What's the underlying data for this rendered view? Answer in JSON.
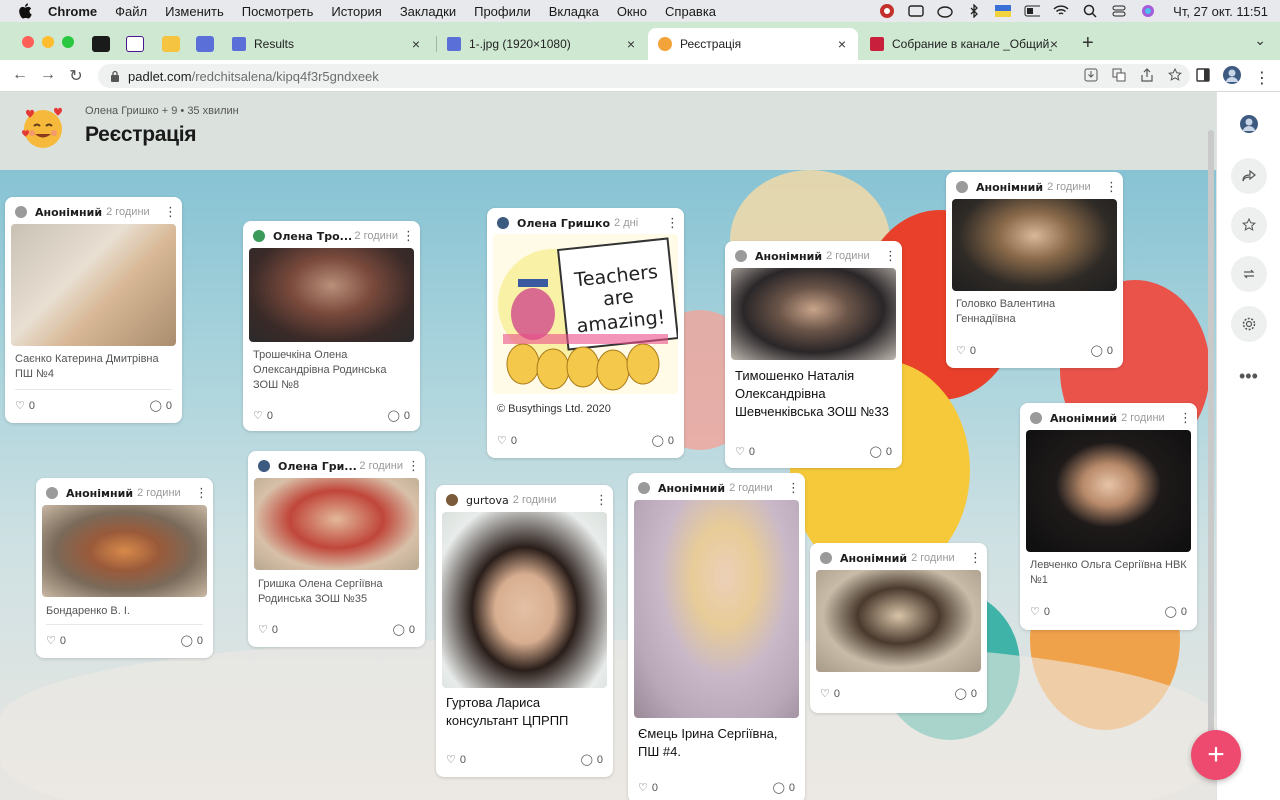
{
  "menubar": {
    "app": "Chrome",
    "items": [
      "Файл",
      "Изменить",
      "Посмотреть",
      "История",
      "Закладки",
      "Профили",
      "Вкладка",
      "Окно",
      "Справка"
    ],
    "clock": "Чт, 27 окт.  11:51"
  },
  "tabs": [
    {
      "title": "Results"
    },
    {
      "title": "1-.jpg (1920×1080)"
    },
    {
      "title": "Реєстрація"
    },
    {
      "title": "Собрание в канале _Общий_"
    }
  ],
  "address": {
    "host": "padlet.com",
    "path": "/redchitsalena/kipq4f3r5gndxeek"
  },
  "padlet": {
    "byline": "Олена Гришко + 9 • 35 хвилин",
    "title": "Реєстрація"
  },
  "posts": [
    {
      "author": "Анонімний",
      "ago": "2 години",
      "caption": "Саєнко Катерина Дмитрівна ПШ №4",
      "likes": "0",
      "comments": "0"
    },
    {
      "author": "Олена Тро...",
      "ago": "2 години",
      "caption": "Трошечкіна Олена Олександрівна Родинська ЗОШ №8",
      "likes": "0",
      "comments": "0"
    },
    {
      "author": "Олена Гришко",
      "ago": "2 дні",
      "caption": "© Busythings Ltd. 2020",
      "image_text": "Teachers are amazing!",
      "likes": "0",
      "comments": "0"
    },
    {
      "author": "Анонімний",
      "ago": "2 години",
      "caption": "Тимошенко Наталія Олександрівна Шевченківська ЗОШ №33",
      "likes": "0",
      "comments": "0"
    },
    {
      "author": "Анонімний",
      "ago": "2 години",
      "caption": "Головко Валентина Геннадіївна",
      "likes": "0",
      "comments": "0"
    },
    {
      "author": "Анонімний",
      "ago": "2 години",
      "caption": "Бондаренко В. І.",
      "likes": "0",
      "comments": "0"
    },
    {
      "author": "Олена Гри...",
      "ago": "2 години",
      "caption": "Гришка Олена Сергіївна Родинська ЗОШ №35",
      "likes": "0",
      "comments": "0"
    },
    {
      "author": "gurtova",
      "ago": "2 години",
      "caption": "Гуртова Лариса консультант ЦПРПП",
      "likes": "0",
      "comments": "0"
    },
    {
      "author": "Анонімний",
      "ago": "2 години",
      "caption": "Ємець Ірина Сергіївна, ПШ #4.",
      "likes": "0",
      "comments": "0"
    },
    {
      "author": "Анонімний",
      "ago": "2 години",
      "caption": "",
      "likes": "0",
      "comments": "0"
    },
    {
      "author": "Анонімний",
      "ago": "2 години",
      "caption": "Левченко Ольга Сергіївна НВК №1",
      "likes": "0",
      "comments": "0"
    }
  ],
  "colors": {
    "tabbar": "#cfe8d2",
    "fab": "#ee4a6f",
    "sky_top": "#87c3d4"
  },
  "icons": [
    "apple-icon",
    "heart-icon",
    "comment-icon",
    "share-icon",
    "star-icon",
    "remake-icon",
    "gear-icon",
    "more-icon",
    "plus-icon"
  ]
}
